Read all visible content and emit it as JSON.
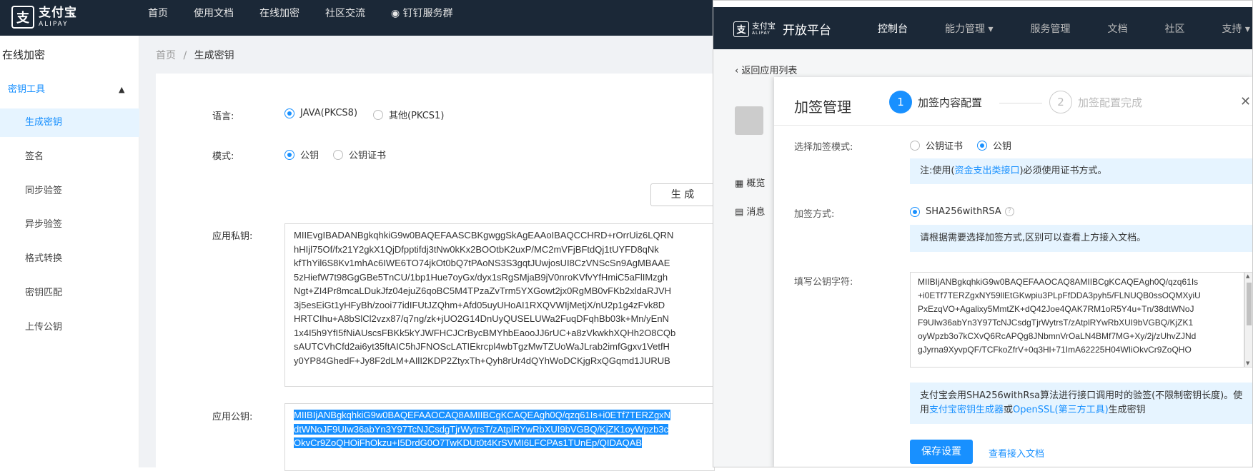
{
  "header": {
    "logo_cn": "支付宝",
    "logo_en": "ALIPAY",
    "nav": [
      "首页",
      "使用文档",
      "在线加密",
      "社区交流",
      "钉钉服务群"
    ]
  },
  "sidebar": {
    "title": "在线加密",
    "group": "密钥工具",
    "items": [
      "生成密钥",
      "签名",
      "同步验签",
      "异步验签",
      "格式转换",
      "密钥匹配",
      "上传公钥"
    ]
  },
  "breadcrumb": {
    "home": "首页",
    "sep": "/",
    "current": "生成密钥"
  },
  "form": {
    "lang_label": "语言:",
    "lang_options": [
      "JAVA(PKCS8)",
      "其他(PKCS1)"
    ],
    "mode_label": "模式:",
    "mode_options": [
      "公钥",
      "公钥证书"
    ],
    "generate_button": "生 成",
    "private_label": "应用私钥:",
    "private_lines": [
      "MIIEvgIBADANBgkqhkiG9w0BAQEFAASCBKgwggSkAgEAAoIBAQCCHRD+rOrrUiz6LQRN",
      "hHIjl75Of/fx21Y2gkX1QjDfpptifdj3tNw0kKx2BOOtbK2uxP/MC2mVFjBFtdQj1tUYFD8qNk",
      "kfThYil6S8Kv1mhAc6IWE6TO74jkOt0bQ7tPAoNS3S3gqtJUwjosUI8CzVNScSn9AgMBAAE",
      "5zHiefW7t98GgGBe5TnCU/1bp1Hue7oyGx/dyx1sRgSMjaB9jV0nroKVfvYfHmiC5aFlIMzgh",
      "Ngt+ZI4Pr8mcaLDukJfz04ejuZ6qoBC5M4TPzaZvTrm5YXGowt2jx0RgMB0vFKb2xldaRJVH",
      "3j5esEiGt1yHFyBh/zooi77idIFUtJZQhm+Afd05uyUHoAI1RXQVWIjMetjX/nU2p1g4zFvk8D",
      "HRTCIhu+A8bSlCl2vzx87/q7ng/zk+jUO2G14DnUyQUSELUWa2FuqDFqhBb03k+Mn/yEnN",
      "1x4I5h9YfI5fNiAUscsFBKk5kYJWFHCJCrBycBMYhbEaooJJ6rUC+a8zVkwkhXQHh2O8CQb",
      "sAUTCVhCfd2ai6yt35ftAIC5hJFNOScLATIEkrcpl4wbTgzMwTZUoWaJLrab2imfGgxv1VetfH",
      "y0YP84GhedF+Jy8F2dLM+AIlI2KDP2ZtyxTh+Qyh8rUr4dQYhWoDCKjgRxQGqmd1JURUB"
    ],
    "public_label": "应用公钥:",
    "public_lines": [
      "MIIBIjANBgkqhkiG9w0BAQEFAAOCAQ8AMIIBCgKCAQEAgh0Q/qzq61Is+i0ETf7TERZgxN",
      "dtWNoJF9UIw36abYn3Y97TcNJCsdgTjrWytrsT/zAtplRYwRbXUI9bVGBQ/KjZK1oyWpzb3c",
      "OkvCr9ZoQHOiFhOkzu+I5DrdG0O7TwKDUt0t4KrSVMI6LFCPAs1TUnEp/QIDAQAB"
    ]
  },
  "popup": {
    "logo_cn": "支付宝",
    "logo_en": "ALIPAY",
    "platform": "开放平台",
    "nav": [
      "控制台",
      "能力管理",
      "服务管理",
      "文档",
      "社区",
      "支持"
    ],
    "back": "返回应用列表",
    "side": [
      "概览",
      "消息"
    ],
    "modal": {
      "title": "加签管理",
      "step1_num": "1",
      "step1": "加签内容配置",
      "step2_num": "2",
      "step2": "加签配置完成",
      "mode_label": "选择加签模式:",
      "mode_options": [
        "公钥证书",
        "公钥"
      ],
      "note1_pre": "注:使用(",
      "note1_link": "资金支出类接口",
      "note1_post": ")必须使用证书方式。",
      "method_label": "加签方式:",
      "method_option": "SHA256withRSA",
      "note2": "请根据需要选择加签方式,区别可以查看上方接入文档。",
      "pk_label": "填写公钥字符:",
      "pk_lines": [
        "MIIBIjANBgkqhkiG9w0BAQEFAAOCAQ8AMIIBCgKCAQEAgh0Q/qzq61Is",
        "+i0ETf7TERZgxNY59llEtGKwpiu3PLpFfDDA3pyh5/FLNUQB0ssOQMXyiU",
        "PxEzqVO+Agalixy5MmtZK+dQ42Joe4QAK7RM1oR5Y4u+Tn/38dtWNoJ",
        "F9UIw36abYn3Y97TcNJCsdgTjrWytrsT/zAtplRYwRbXUI9bVGBQ/KjZK1",
        "oyWpzb3o7kCXvQ6RcAPQg8JNbmnVrOaLN4BMf7MG+Xy/2j/zUhvZJNd",
        "gJyrna9XyvpQF/TCFkoZfrV+0q3Hl+71ImA62225H04WIiOkvCr9ZoQHO"
      ],
      "note3_pre": "支付宝会用SHA256withRsa算法进行接口调用时的验签(不限制密钥长度)。使用",
      "note3_link1": "支付宝密钥生成器",
      "note3_mid": "或",
      "note3_link2": "OpenSSL(第三方工具)",
      "note3_post": "生成密钥",
      "save": "保存设置",
      "doc": "查看接入文档"
    }
  }
}
